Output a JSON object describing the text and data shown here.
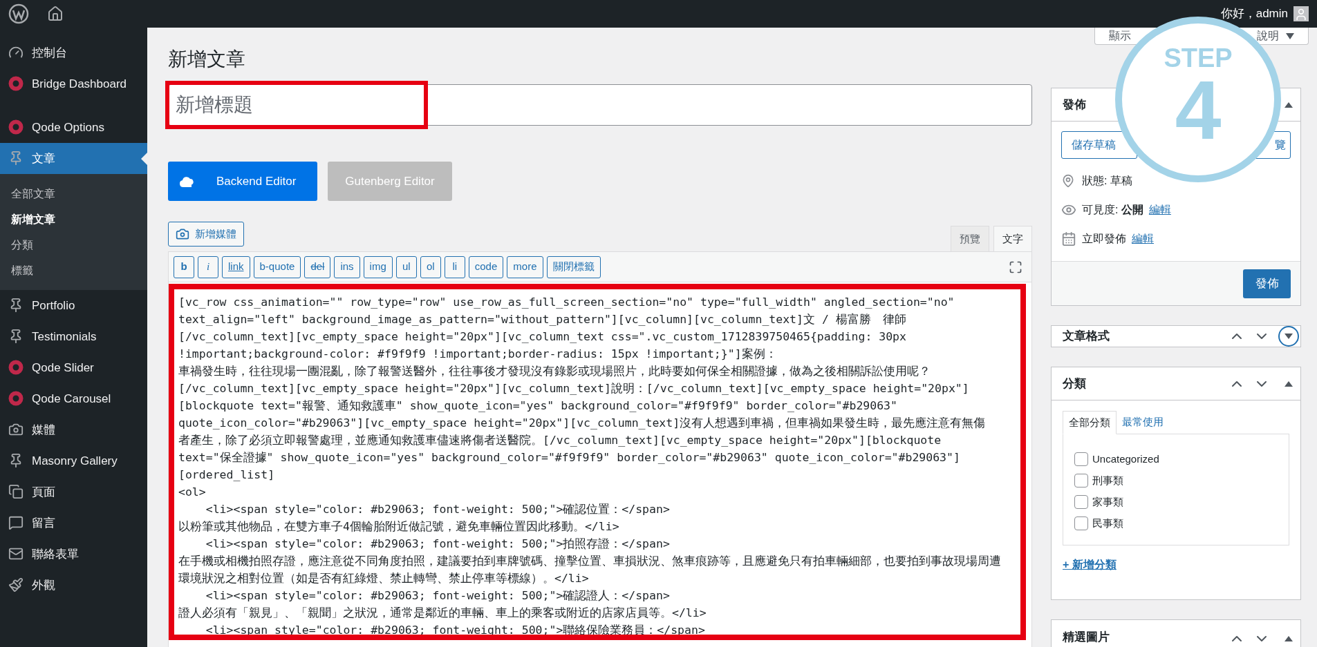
{
  "top_bar": {
    "greeting": "你好，admin"
  },
  "sidebar": {
    "items": [
      {
        "label": "控制台",
        "kind": "dashboard",
        "selected": false
      },
      {
        "label": "Bridge Dashboard",
        "kind": "qode",
        "selected": false
      },
      {
        "label": "Qode Options",
        "kind": "qode",
        "selected": false
      },
      {
        "label": "文章",
        "kind": "pin",
        "selected": true,
        "children": [
          {
            "label": "全部文章",
            "selected": false
          },
          {
            "label": "新增文章",
            "selected": true
          },
          {
            "label": "分類",
            "selected": false
          },
          {
            "label": "標籤",
            "selected": false
          }
        ]
      },
      {
        "label": "Portfolio",
        "kind": "pin",
        "selected": false
      },
      {
        "label": "Testimonials",
        "kind": "pin",
        "selected": false
      },
      {
        "label": "Qode Slider",
        "kind": "qode",
        "selected": false
      },
      {
        "label": "Qode Carousel",
        "kind": "qode",
        "selected": false
      },
      {
        "label": "媒體",
        "kind": "media",
        "selected": false
      },
      {
        "label": "Masonry Gallery",
        "kind": "pin",
        "selected": false
      },
      {
        "label": "頁面",
        "kind": "page",
        "selected": false
      },
      {
        "label": "留言",
        "kind": "comment",
        "selected": false
      },
      {
        "label": "聯絡表單",
        "kind": "mail",
        "selected": false
      },
      {
        "label": "外觀",
        "kind": "brush",
        "selected": false
      }
    ]
  },
  "page_title": "新增文章",
  "title_field": {
    "placeholder": "新增標題"
  },
  "editor_switch": [
    {
      "label": "Backend Editor",
      "selected": true
    },
    {
      "label": "Gutenberg Editor",
      "selected": false
    }
  ],
  "media_button": "新增媒體",
  "editor_tabs": [
    {
      "label": "預覽",
      "selected": false
    },
    {
      "label": "文字",
      "selected": true
    }
  ],
  "quicktags": [
    {
      "label": "b",
      "kind": "bold"
    },
    {
      "label": "i",
      "kind": "italic"
    },
    {
      "label": "link",
      "kind": "link"
    },
    {
      "label": "b-quote",
      "kind": "plain"
    },
    {
      "label": "del",
      "kind": "strike"
    },
    {
      "label": "ins",
      "kind": "plain"
    },
    {
      "label": "img",
      "kind": "plain"
    },
    {
      "label": "ul",
      "kind": "plain"
    },
    {
      "label": "ol",
      "kind": "plain"
    },
    {
      "label": "li",
      "kind": "plain"
    },
    {
      "label": "code",
      "kind": "plain"
    },
    {
      "label": "more",
      "kind": "plain"
    },
    {
      "label": "關閉標籤",
      "kind": "plain"
    }
  ],
  "content_lines": [
    "[vc_row css_animation=\"\" row_type=\"row\" use_row_as_full_screen_section=\"no\" type=\"full_width\" angled_section=\"no\"",
    "text_align=\"left\" background_image_as_pattern=\"without_pattern\"][vc_column][vc_column_text]文 / 楊富勝　律師",
    "[/vc_column_text][vc_empty_space height=\"20px\"][vc_column_text css=\".vc_custom_1712839750465{padding: 30px",
    "!important;background-color: #f9f9f9 !important;border-radius: 15px !important;}\"]案例：",
    "車禍發生時，往往現場一團混亂，除了報警送醫外，往往事後才發現沒有錄影或現場照片，此時要如何保全相關證據，做為之後相關訴訟使用呢？",
    "[/vc_column_text][vc_empty_space height=\"20px\"][vc_column_text]說明：[/vc_column_text][vc_empty_space height=\"20px\"]",
    "[blockquote text=\"報警、通知救護車\" show_quote_icon=\"yes\" background_color=\"#f9f9f9\" border_color=\"#b29063\"",
    "quote_icon_color=\"#b29063\"][vc_empty_space height=\"20px\"][vc_column_text]沒有人想遇到車禍，但車禍如果發生時，最先應注意有無傷",
    "者產生，除了必須立即報警處理，並應通知救護車儘速將傷者送醫院。[/vc_column_text][vc_empty_space height=\"20px\"][blockquote",
    "text=\"保全證據\" show_quote_icon=\"yes\" background_color=\"#f9f9f9\" border_color=\"#b29063\" quote_icon_color=\"#b29063\"]",
    "[ordered_list]",
    "<ol>",
    "\t<li><span style=\"color: #b29063; font-weight: 500;\">確認位置：</span>",
    "以粉筆或其他物品，在雙方車子4個輪胎附近做記號，避免車輛位置因此移動。</li>",
    "\t<li><span style=\"color: #b29063; font-weight: 500;\">拍照存證：</span>",
    "在手機或相機拍照存證，應注意從不同角度拍照，建議要拍到車牌號碼、撞擊位置、車損狀況、煞車痕跡等，且應避免只有拍車輛細部，也要拍到事故現場周遭",
    "環境狀況之相對位置（如是否有紅綠燈、禁止轉彎、禁止停車等標線）。</li>",
    "\t<li><span style=\"color: #b29063; font-weight: 500;\">確認證人：</span>",
    "證人必須有「親見」、「親聞」之狀況，通常是鄰近的車輛、車上的乘客或附近的店家店員等。</li>",
    "\t<li><span style=\"color: #b29063; font-weight: 500;\">聯絡保險業務員：</span>"
  ],
  "screen_options": {
    "left": "顯示",
    "right": "說明"
  },
  "publish_box": {
    "title": "發佈",
    "save_button": "儲存草稿",
    "preview_button": "覽",
    "status": "狀態: 草稿",
    "visibility_label": "可見度:",
    "visibility_value": "公開",
    "visibility_link": "編輯",
    "schedule_label": "立即發佈",
    "schedule_link": "編輯",
    "publish_button": "發佈"
  },
  "format_box": {
    "title": "文章格式"
  },
  "category_box": {
    "title": "分類",
    "tabs": [
      {
        "label": "全部分類",
        "selected": true
      },
      {
        "label": "最常使用",
        "selected": false
      }
    ],
    "categories": [
      {
        "label": "Uncategorized",
        "checked": false
      },
      {
        "label": "刑事類",
        "checked": false
      },
      {
        "label": "家事類",
        "checked": false
      },
      {
        "label": "民事類",
        "checked": false
      }
    ],
    "add_link": "+ 新增分類"
  },
  "featured_box": {
    "title": "精選圖片"
  },
  "annotation": {
    "step_label": "STEP",
    "step_number": "4"
  }
}
